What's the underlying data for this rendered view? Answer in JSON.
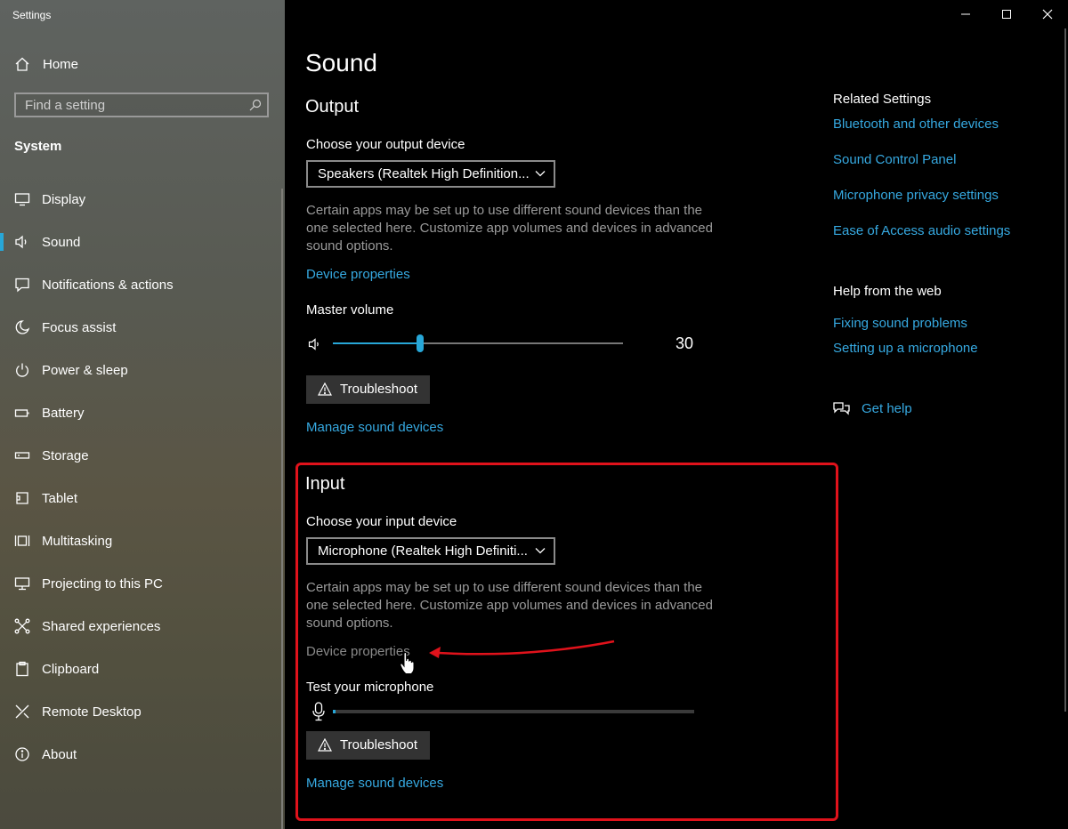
{
  "window": {
    "title": "Settings"
  },
  "sidebar": {
    "home_label": "Home",
    "search_placeholder": "Find a setting",
    "section_label": "System",
    "items": [
      {
        "label": "Display",
        "icon": "monitor-icon"
      },
      {
        "label": "Sound",
        "icon": "speaker-icon",
        "active": true
      },
      {
        "label": "Notifications & actions",
        "icon": "notification-icon"
      },
      {
        "label": "Focus assist",
        "icon": "moon-icon"
      },
      {
        "label": "Power & sleep",
        "icon": "power-icon"
      },
      {
        "label": "Battery",
        "icon": "battery-icon"
      },
      {
        "label": "Storage",
        "icon": "storage-icon"
      },
      {
        "label": "Tablet",
        "icon": "tablet-icon"
      },
      {
        "label": "Multitasking",
        "icon": "multitasking-icon"
      },
      {
        "label": "Projecting to this PC",
        "icon": "projecting-icon"
      },
      {
        "label": "Shared experiences",
        "icon": "shared-experiences-icon"
      },
      {
        "label": "Clipboard",
        "icon": "clipboard-icon"
      },
      {
        "label": "Remote Desktop",
        "icon": "remote-desktop-icon"
      },
      {
        "label": "About",
        "icon": "info-icon"
      }
    ]
  },
  "main": {
    "title": "Sound",
    "output": {
      "heading": "Output",
      "device_label": "Choose your output device",
      "device_value": "Speakers (Realtek High Definition...",
      "description": "Certain apps may be set up to use different sound devices than the one selected here. Customize app volumes and devices in advanced sound options.",
      "device_properties": "Device properties",
      "volume_label": "Master volume",
      "volume_value": "30",
      "volume_fraction": 0.3,
      "troubleshoot": "Troubleshoot",
      "manage": "Manage sound devices"
    },
    "input": {
      "heading": "Input",
      "device_label": "Choose your input device",
      "device_value": "Microphone (Realtek High Definiti...",
      "description": "Certain apps may be set up to use different sound devices than the one selected here. Customize app volumes and devices in advanced sound options.",
      "device_properties": "Device properties",
      "test_label": "Test your microphone",
      "troubleshoot": "Troubleshoot",
      "manage": "Manage sound devices"
    }
  },
  "related": {
    "heading": "Related Settings",
    "links": [
      "Bluetooth and other devices",
      "Sound Control Panel",
      "Microphone privacy settings",
      "Ease of Access audio settings"
    ]
  },
  "help": {
    "heading": "Help from the web",
    "links": [
      "Fixing sound problems",
      "Setting up a microphone"
    ],
    "get_help": "Get help"
  },
  "colors": {
    "accent": "#27a7d8",
    "link": "#36a9e1",
    "highlight": "#e0121b"
  }
}
